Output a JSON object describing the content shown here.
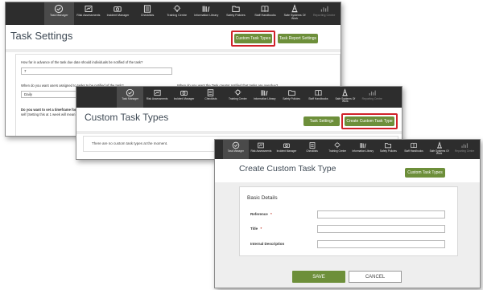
{
  "nav_items": [
    {
      "label": "Task Manager",
      "icon": "check-circle-icon"
    },
    {
      "label": "Risk Assessments",
      "icon": "risk-assessment-icon"
    },
    {
      "label": "Incident Manager",
      "icon": "incident-camera-icon"
    },
    {
      "label": "Checklists",
      "icon": "checklist-icon"
    },
    {
      "label": "Training Centre",
      "icon": "lightbulb-icon"
    },
    {
      "label": "Information Library",
      "icon": "library-icon"
    },
    {
      "label": "Safety Policies",
      "icon": "policy-folder-icon"
    },
    {
      "label": "Staff Handbooks",
      "icon": "handbook-icon"
    },
    {
      "label": "Safe Systems Of Work",
      "icon": "cone-icon"
    },
    {
      "label": "Reporting Centre",
      "icon": "reporting-chart-icon"
    }
  ],
  "window1": {
    "title": "Task Settings",
    "custom_task_types_button": "Custom Task Types",
    "task_report_settings_button": "Task Report Settings",
    "q_advance_notify": "How far in advance of the task due date should individuals be notified of the task?",
    "advance_value": "7",
    "q_assigned_notify": "When do you want users assigned to tasks to be notified of the task?",
    "assigned_value": "Daily",
    "q_creator_notify": "When do you want the Task creator notified that tasks are overdue?",
    "q_timeframe": "Do you want to set a timeframe for",
    "q_timeframe_2": "self (Setting this at 1 week will mean"
  },
  "window2": {
    "title": "Custom Task Types",
    "task_settings_button": "Task Settings",
    "create_custom_task_type_button": "Create Custom Task Type",
    "empty_message": "There are no custom task types at the moment."
  },
  "window3": {
    "title": "Create Custom Task Type",
    "custom_task_types_button": "Custom Task Types",
    "section_title": "Basic Details",
    "reference_label": "Reference",
    "title_label": "Title",
    "required_marker": "*",
    "internal_description_label": "Internal Description",
    "save_button": "SAVE",
    "cancel_button": "CANCEL"
  },
  "colors": {
    "nav_bg": "#2d2d2d",
    "accent_green": "#6d8f3a",
    "highlight_red": "#d0222a"
  }
}
